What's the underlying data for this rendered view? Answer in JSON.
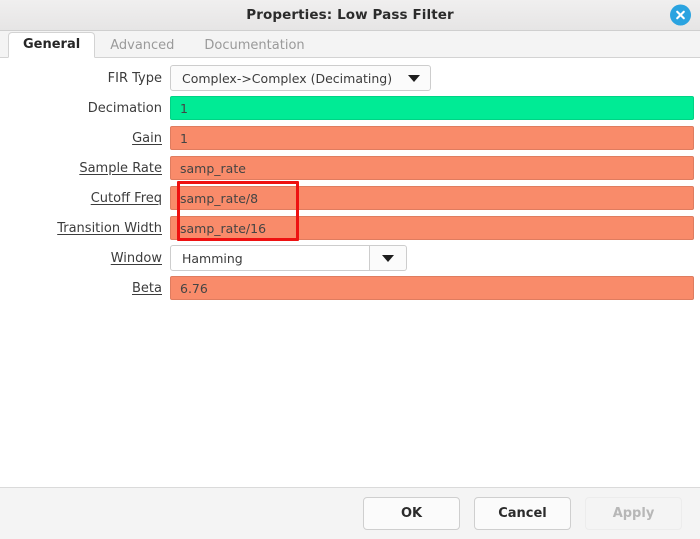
{
  "window": {
    "title": "Properties: Low Pass Filter",
    "close_icon": "close-icon"
  },
  "tabs": [
    {
      "label": "General",
      "active": true
    },
    {
      "label": "Advanced",
      "active": false
    },
    {
      "label": "Documentation",
      "active": false
    }
  ],
  "form": {
    "rows": [
      {
        "label": "FIR Type",
        "underlined": false,
        "kind": "combo",
        "value": "Complex->Complex (Decimating)"
      },
      {
        "label": "Decimation",
        "underlined": false,
        "kind": "entry",
        "color": "green",
        "value": "1"
      },
      {
        "label": "Gain",
        "underlined": true,
        "kind": "entry",
        "color": "orange",
        "value": "1"
      },
      {
        "label": "Sample Rate",
        "underlined": true,
        "kind": "entry",
        "color": "orange",
        "value": "samp_rate"
      },
      {
        "label": "Cutoff Freq",
        "underlined": true,
        "kind": "entry",
        "color": "orange",
        "value": "samp_rate/8"
      },
      {
        "label": "Transition Width",
        "underlined": true,
        "kind": "entry",
        "color": "orange",
        "value": "samp_rate/16"
      },
      {
        "label": "Window",
        "underlined": true,
        "kind": "combo-split",
        "value": "Hamming"
      },
      {
        "label": "Beta",
        "underlined": true,
        "kind": "entry",
        "color": "orange",
        "value": "6.76"
      }
    ]
  },
  "annotation": {
    "highlight_color": "#ee1111",
    "covers": [
      "Cutoff Freq",
      "Transition Width"
    ]
  },
  "footer": {
    "buttons": [
      {
        "label": "OK",
        "disabled": false
      },
      {
        "label": "Cancel",
        "disabled": false
      },
      {
        "label": "Apply",
        "disabled": true
      }
    ]
  },
  "colors": {
    "valid_field": "#00eb95",
    "invalid_field": "#f98b6a",
    "close_button": "#2aa3e0"
  }
}
